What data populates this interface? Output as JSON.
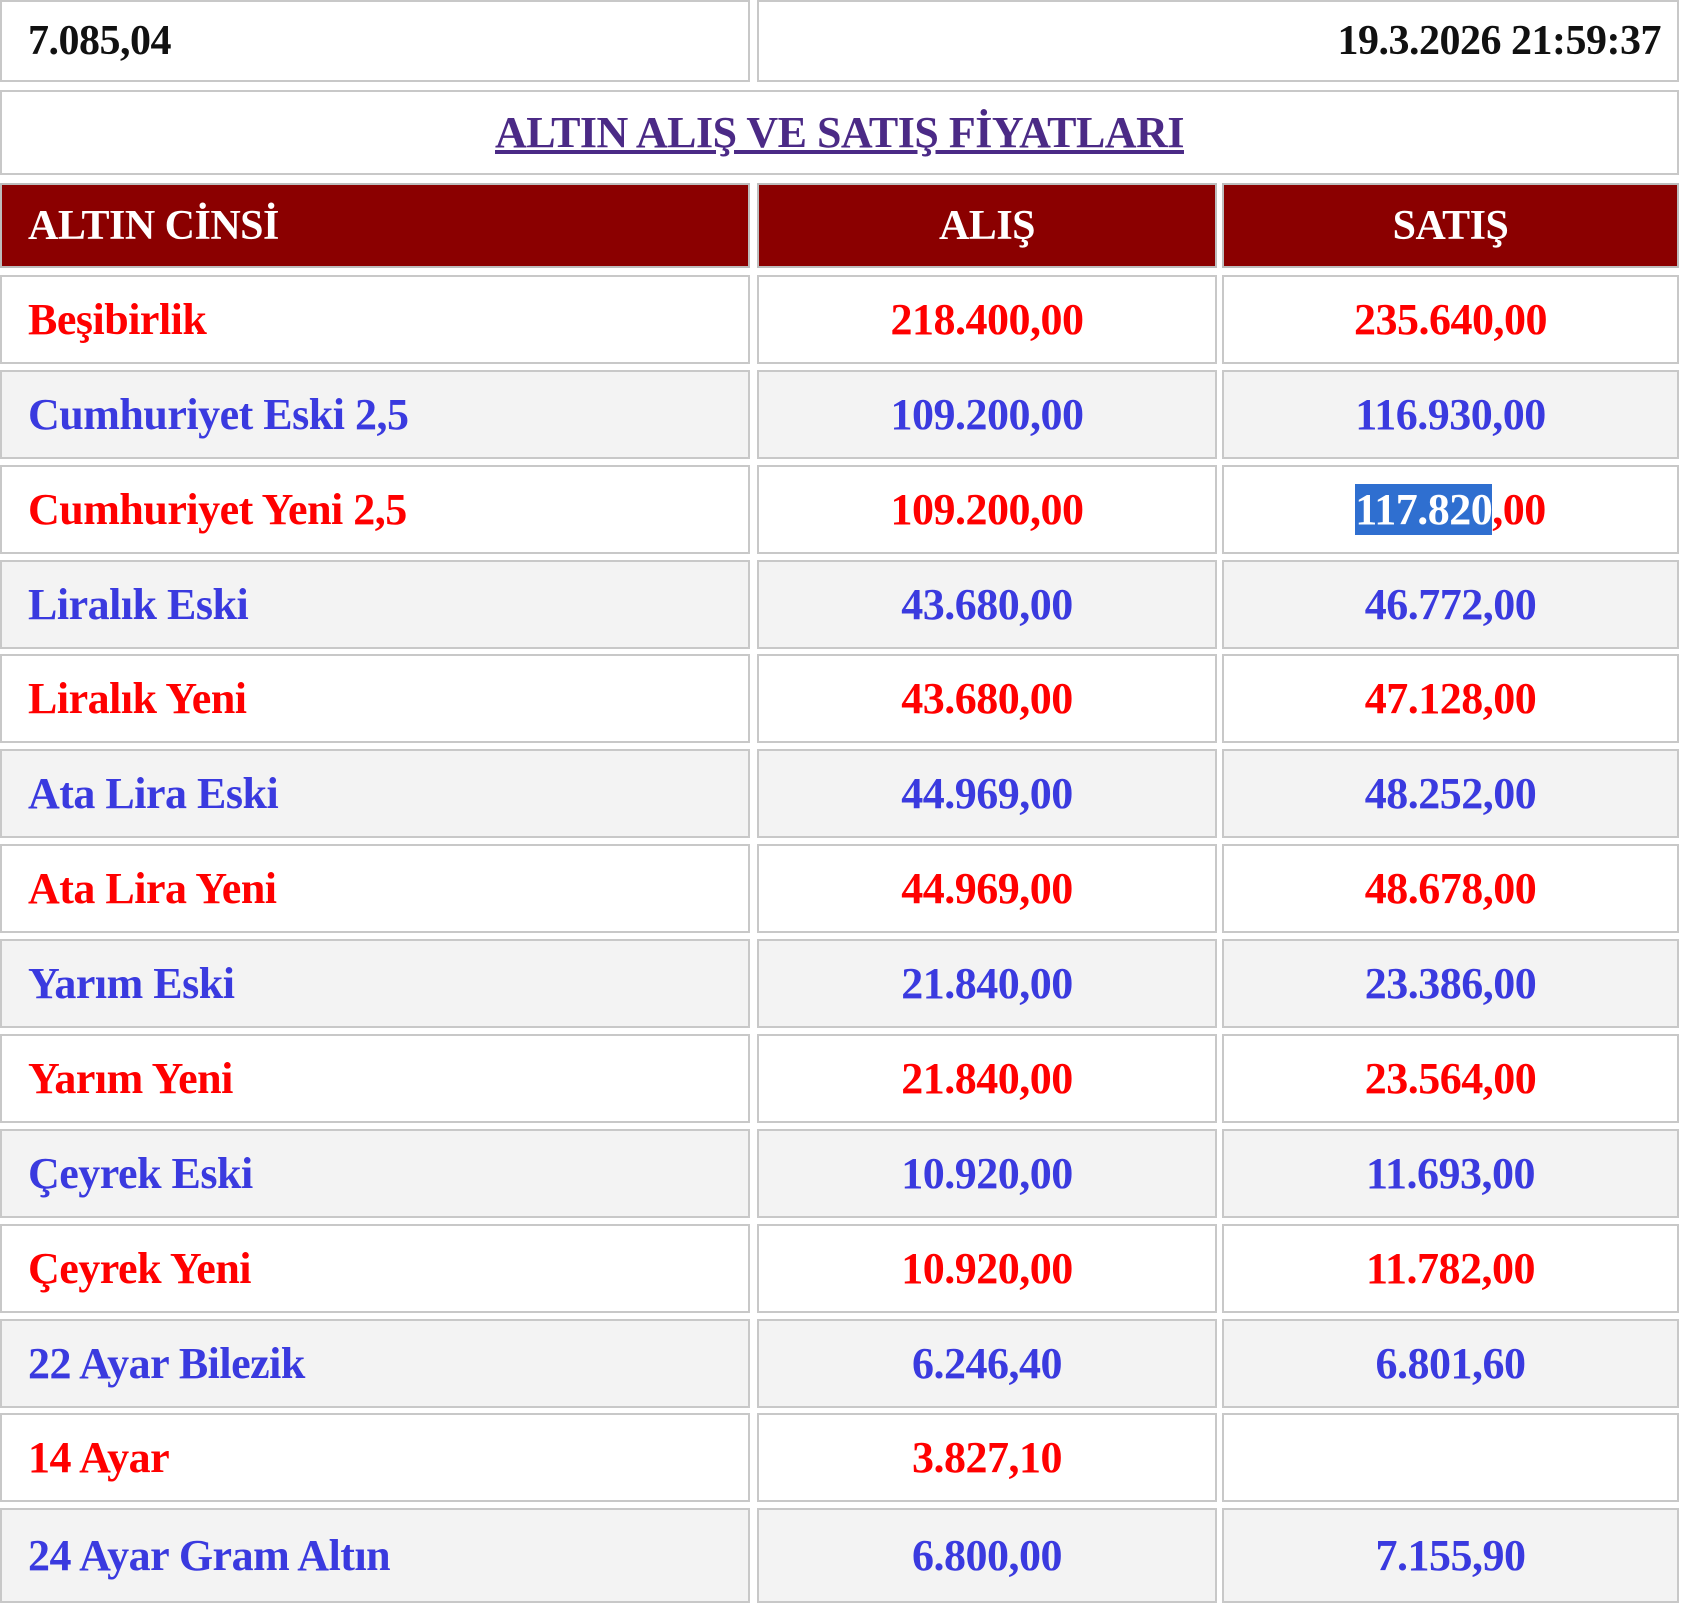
{
  "top": {
    "left_value": "7.085,04",
    "datetime": "19.3.2026 21:59:37"
  },
  "title": "ALTIN ALIŞ VE SATIŞ FİYATLARI",
  "headers": {
    "type": "ALTIN CİNSİ",
    "buy": "ALIŞ",
    "sell": "SATIŞ"
  },
  "colors": {
    "header_bg": "#8b0000",
    "red_text": "#ff0000",
    "blue_text": "#3a3adf",
    "title_text": "#4b2a86",
    "alt_row_bg": "#f3f3f3",
    "selection_bg": "#2f6fd0"
  },
  "rows": [
    {
      "name": "Beşibirlik",
      "buy": "218.400,00",
      "sell": "235.640,00",
      "color": "red"
    },
    {
      "name": "Cumhuriyet Eski 2,5",
      "buy": "109.200,00",
      "sell": "116.930,00",
      "color": "blue"
    },
    {
      "name": "Cumhuriyet Yeni 2,5",
      "buy": "109.200,00",
      "sell": "117.820,00",
      "sell_selected": "117.820",
      "sell_rest": ",00",
      "color": "red"
    },
    {
      "name": "Liralık Eski",
      "buy": "43.680,00",
      "sell": "46.772,00",
      "color": "blue"
    },
    {
      "name": "Liralık Yeni",
      "buy": "43.680,00",
      "sell": "47.128,00",
      "color": "red"
    },
    {
      "name": "Ata Lira Eski",
      "buy": "44.969,00",
      "sell": "48.252,00",
      "color": "blue"
    },
    {
      "name": "Ata Lira Yeni",
      "buy": "44.969,00",
      "sell": "48.678,00",
      "color": "red"
    },
    {
      "name": "Yarım Eski",
      "buy": "21.840,00",
      "sell": "23.386,00",
      "color": "blue"
    },
    {
      "name": "Yarım Yeni",
      "buy": "21.840,00",
      "sell": "23.564,00",
      "color": "red"
    },
    {
      "name": "Çeyrek Eski",
      "buy": "10.920,00",
      "sell": "11.693,00",
      "color": "blue"
    },
    {
      "name": "Çeyrek Yeni",
      "buy": "10.920,00",
      "sell": "11.782,00",
      "color": "red"
    },
    {
      "name": "22 Ayar Bilezik",
      "buy": "6.246,40",
      "sell": "6.801,60",
      "color": "blue"
    },
    {
      "name": "14 Ayar",
      "buy": "3.827,10",
      "sell": "",
      "color": "red"
    },
    {
      "name": "24 Ayar Gram Altın",
      "buy": "6.800,00",
      "sell": "7.155,90",
      "color": "blue"
    }
  ]
}
